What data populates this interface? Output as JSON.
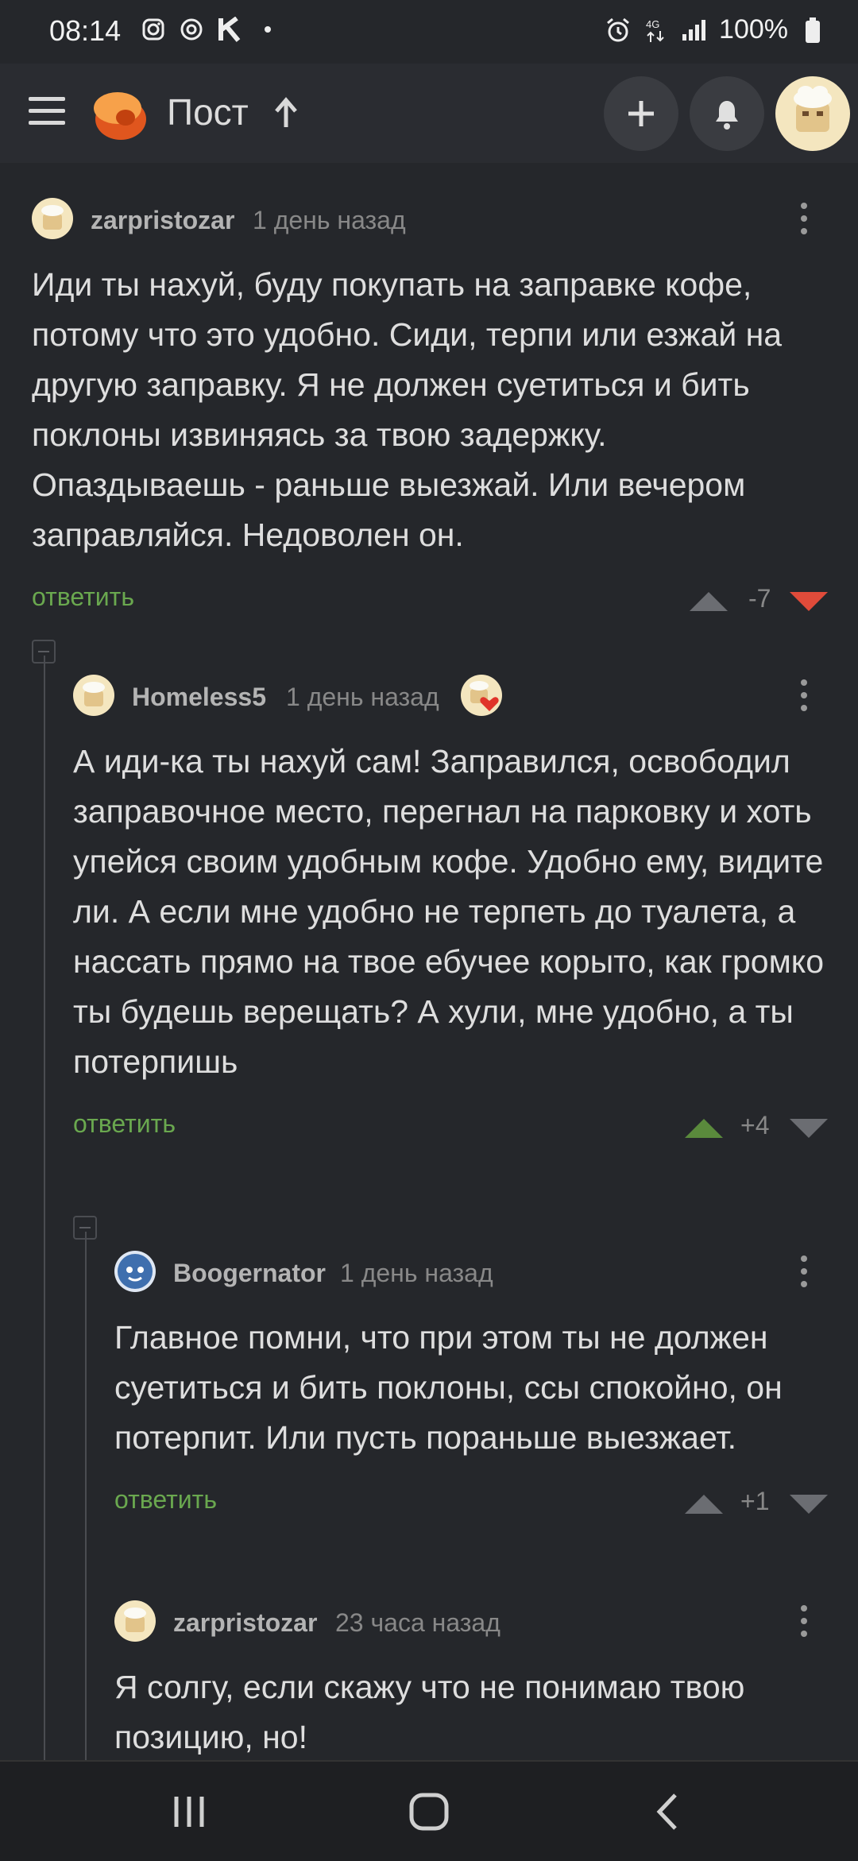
{
  "status_bar": {
    "time": "08:14",
    "left_icons": [
      "instagram-icon",
      "sync-icon",
      "k-icon",
      "dot-icon"
    ],
    "right_icons": [
      "alarm-icon",
      "4g-icon",
      "signal-icon"
    ],
    "battery": "100%"
  },
  "header": {
    "title": "Пост",
    "icons": [
      "menu-icon",
      "logo-icon",
      "arrow-up-icon",
      "plus-icon",
      "bell-icon",
      "avatar"
    ]
  },
  "comments": [
    {
      "author": "zarpristozar",
      "time": "1 день назад",
      "text": "Иди ты нахуй, буду покупать на заправке кофе, потому что это удобно. Сиди, терпи или езжай на другую заправку. Я не должен суетиться и бить поклоны извиняясь за твою задержку. Опаздываешь - раньше выезжай. Или вечером заправляйся. Недоволен он.",
      "reply": "ответить",
      "score": "-7",
      "vote": "down"
    },
    {
      "author": "Homeless5",
      "time": "1 день назад",
      "text": "А иди-ка ты нахуй сам! Заправился, освободил заправочное место, перегнал на парковку и хоть упейся своим удобным кофе. Удобно ему, видите ли. А если мне удобно не терпеть до туалета, а нассать прямо на твое ебучее корыто, как громко ты будешь верещать? А хули, мне удобно, а ты потерпишь",
      "reply": "ответить",
      "score": "+4",
      "vote": "up"
    },
    {
      "author": "Boogernator",
      "time": "1 день назад",
      "text": "Главное помни, что при этом ты не должен суетиться и бить поклоны, ссы спокойно, он потерпит. Или пусть пораньше выезжает.",
      "reply": "ответить",
      "score": "+1",
      "vote": "none"
    },
    {
      "author": "zarpristozar",
      "time": "23 часа назад",
      "text": "Я солгу, если скажу что не понимаю твою позицию, но!"
    }
  ],
  "colors": {
    "background": "#25272b",
    "reply_green": "#6aa84f",
    "downvote_active": "#e04b3a",
    "upvote_active": "#5a8a3c"
  }
}
